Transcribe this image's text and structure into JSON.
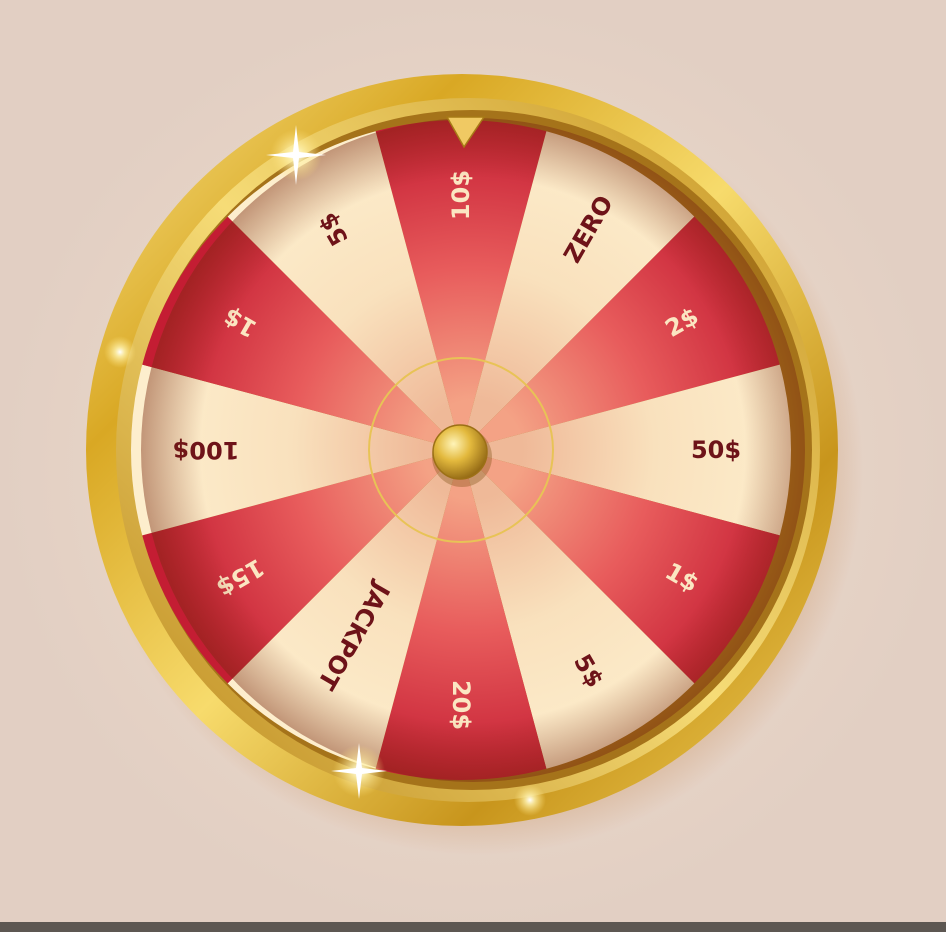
{
  "wheel": {
    "segments": [
      {
        "label": "10$",
        "color": "red"
      },
      {
        "label": "ZERO",
        "color": "cream"
      },
      {
        "label": "2$",
        "color": "red"
      },
      {
        "label": "50$",
        "color": "cream"
      },
      {
        "label": "1$",
        "color": "red"
      },
      {
        "label": "5$",
        "color": "cream"
      },
      {
        "label": "20$",
        "color": "red"
      },
      {
        "label": "JACKPOT",
        "color": "cream"
      },
      {
        "label": "15$",
        "color": "red"
      },
      {
        "label": "100$",
        "color": "cream"
      },
      {
        "label": "1$",
        "color": "red"
      },
      {
        "label": "5$",
        "color": "cream"
      }
    ],
    "pointer": "pointer-triangle-top",
    "hub": "gold-hub-button",
    "colors": {
      "red": "#cf2d3d",
      "red_light": "#f08a78",
      "cream": "#fbe8c6",
      "cream_light": "#f2c29f",
      "text": "#6e1319",
      "text_on_red": "#fbe6c2",
      "gold": "#e6bc3c",
      "background": "#e2cfc3"
    }
  }
}
